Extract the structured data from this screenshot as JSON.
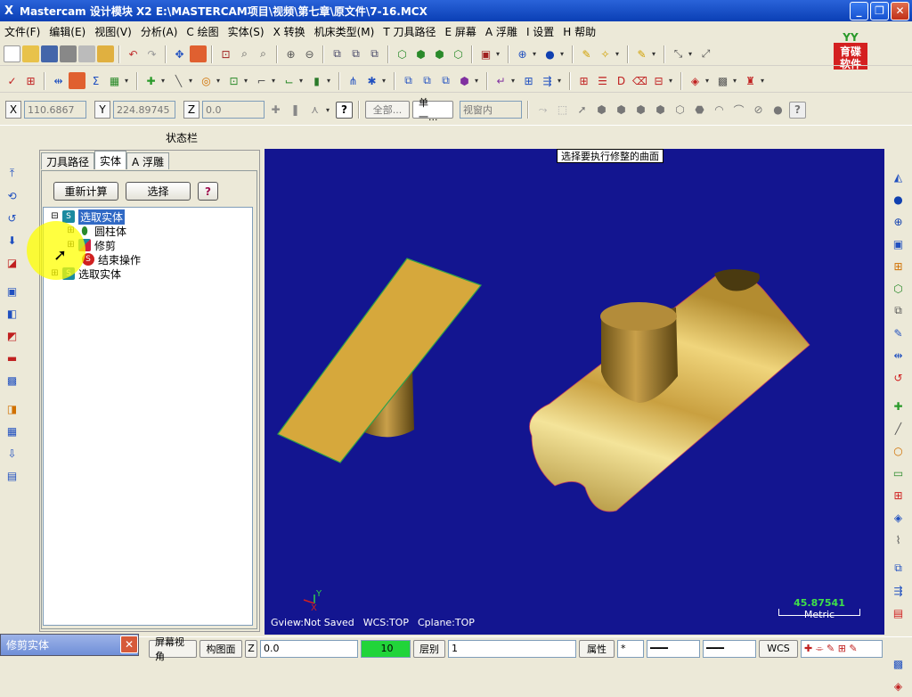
{
  "window": {
    "title": "Mastercam 设计模块  X2  E:\\MASTERCAM项目\\视频\\第七章\\原文件\\7-16.MCX",
    "logo_glyph": "X"
  },
  "menu": [
    "文件(F)",
    "编辑(E)",
    "视图(V)",
    "分析(A)",
    "C 绘图",
    "实体(S)",
    "X 转换",
    "机床类型(M)",
    "T 刀具路径",
    "E 屏幕",
    "A 浮雕",
    "I 设置",
    "H 帮助"
  ],
  "coordbar": {
    "x_label": "X",
    "x_value": "110.6867",
    "y_label": "Y",
    "y_value": "224.89745",
    "z_label": "Z",
    "z_value": "0.0",
    "all_button": "全部...",
    "single_button": "单一...",
    "view_select": "视窗内"
  },
  "status_label": "状态栏",
  "panel": {
    "tabs": [
      "刀具路径",
      "实体",
      "A 浮雕"
    ],
    "active_tab": 1,
    "recalc_button": "重新计算",
    "select_button": "选择",
    "help_button": "?",
    "tree": [
      {
        "label": "选取实体",
        "icon": "solid-icon",
        "level": 0,
        "selected": true,
        "expander": "⊟"
      },
      {
        "label": "圆柱体",
        "icon": "cylinder-icon",
        "level": 1,
        "selected": false,
        "expander": "⊞"
      },
      {
        "label": "修剪",
        "icon": "trim-icon",
        "level": 1,
        "selected": false,
        "expander": "⊞"
      },
      {
        "label": "结束操作",
        "icon": "stop-icon",
        "level": 1,
        "selected": false,
        "expander": ""
      },
      {
        "label": "选取实体",
        "icon": "solid-icon",
        "level": 0,
        "selected": false,
        "expander": "⊞"
      }
    ]
  },
  "viewport": {
    "prompt": "选择要执行修整的曲面",
    "gview": "Gview:Not Saved",
    "wcs": "WCS:TOP",
    "cplane": "Cplane:TOP",
    "scale_value": "45.87541",
    "scale_unit": "Metric",
    "background_color": "#131590",
    "surface_color": "#d6a83c",
    "gnomon_y": "Y",
    "gnomon_x": "X"
  },
  "bottombar": {
    "tooltip_title": "修剪实体",
    "screen_view": "屏幕视角",
    "cplane": "构图面",
    "z_label": "Z",
    "z_value": "0.0",
    "color_value": "10",
    "level_label": "层别",
    "level_value": "1",
    "attributes": "属性",
    "wcs": "WCS"
  },
  "logo": {
    "line1": "育碟",
    "line2": "软件",
    "badge": "YY",
    "color": "#d42020"
  }
}
